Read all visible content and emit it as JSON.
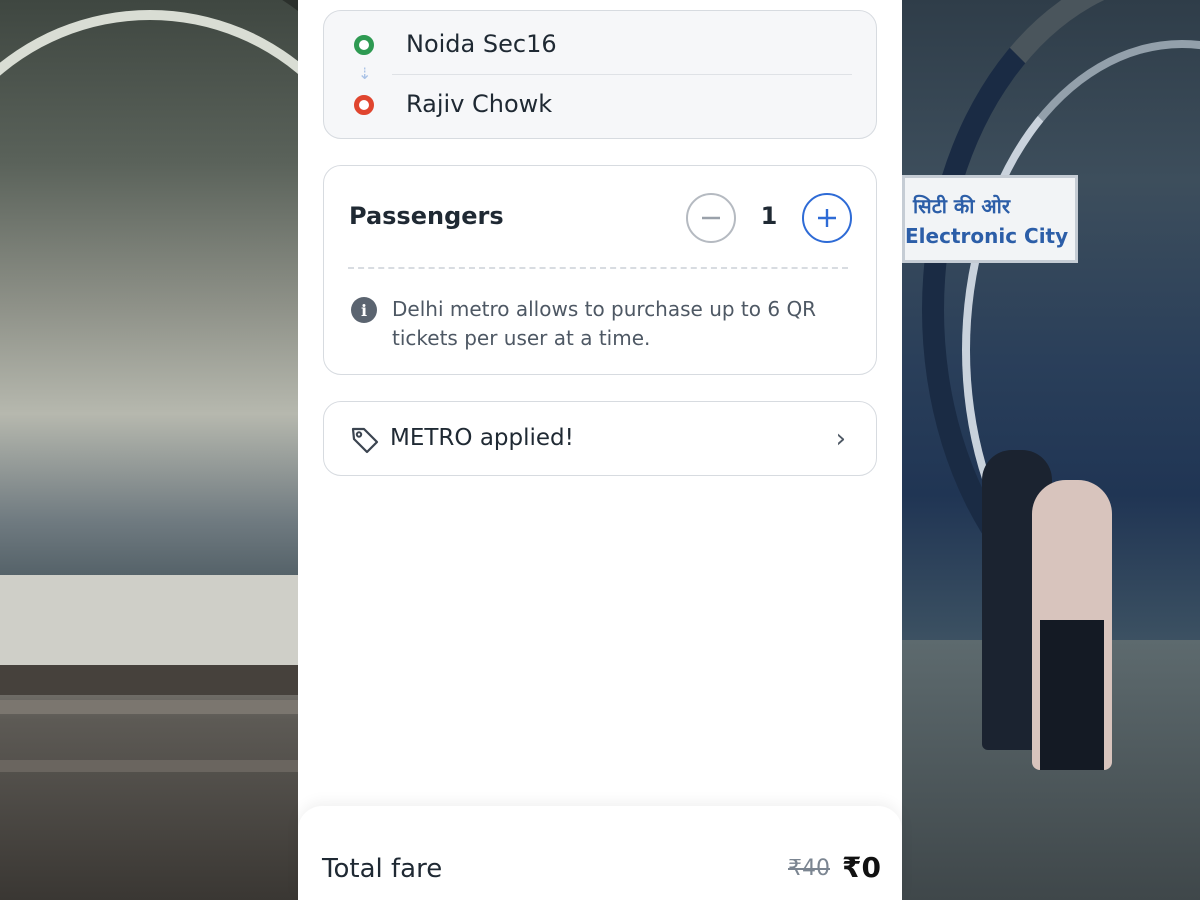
{
  "route": {
    "origin": "Noida Sec16",
    "destination": "Rajiv Chowk"
  },
  "passengers": {
    "title": "Passengers",
    "count": "1",
    "info": "Delhi metro allows to purchase up to 6 QR tickets per user at a time."
  },
  "promo": {
    "label": "METRO applied!"
  },
  "fare": {
    "label": "Total fare",
    "original": "₹40",
    "final": "₹0"
  },
  "background": {
    "sign_hindi": "सिटी की ओर",
    "sign_english": "Electronic City"
  },
  "colors": {
    "origin_dot": "#2e9a52",
    "destination_dot": "#e0452f",
    "accent": "#2e6bd6"
  }
}
